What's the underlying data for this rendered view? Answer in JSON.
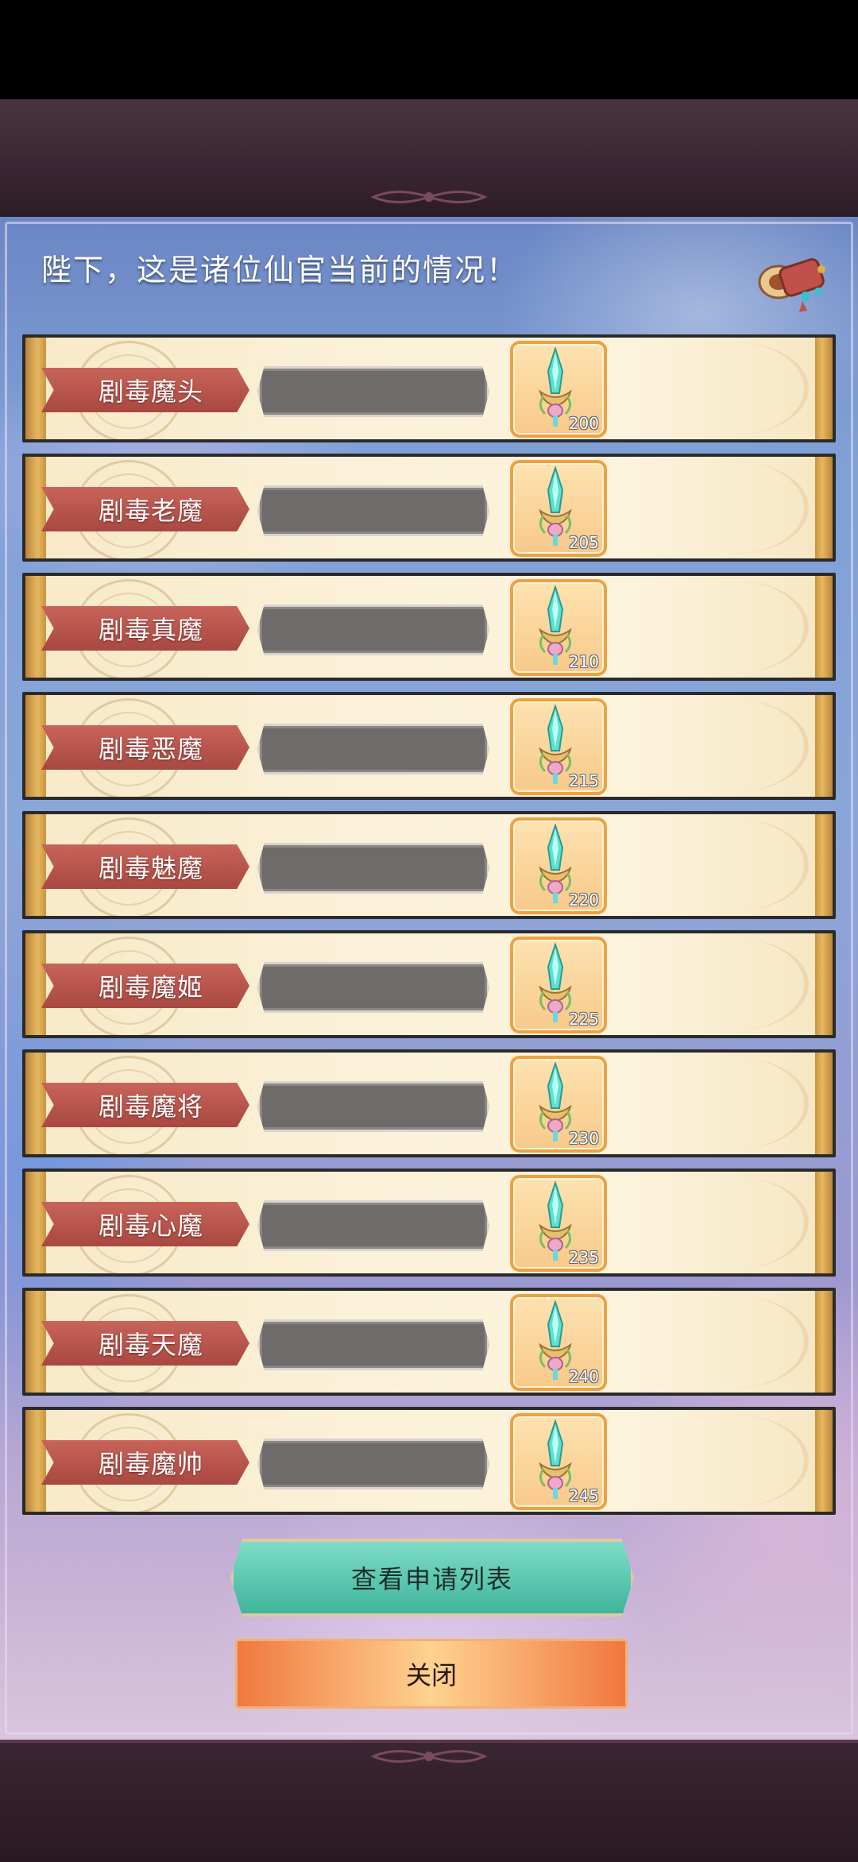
{
  "header": {
    "title": "陛下，这是诸位仙官当前的情况！"
  },
  "officials": [
    {
      "name": "剧毒魔头",
      "level": "200"
    },
    {
      "name": "剧毒老魔",
      "level": "205"
    },
    {
      "name": "剧毒真魔",
      "level": "210"
    },
    {
      "name": "剧毒恶魔",
      "level": "215"
    },
    {
      "name": "剧毒魅魔",
      "level": "220"
    },
    {
      "name": "剧毒魔姬",
      "level": "225"
    },
    {
      "name": "剧毒魔将",
      "level": "230"
    },
    {
      "name": "剧毒心魔",
      "level": "235"
    },
    {
      "name": "剧毒天魔",
      "level": "240"
    },
    {
      "name": "剧毒魔帅",
      "level": "245"
    }
  ],
  "buttons": {
    "view_applications": "查看申请列表",
    "close": "关闭"
  },
  "icons": {
    "corner": "scroll-icon",
    "reward": "sword-icon"
  },
  "colors": {
    "banner_red": "#b8524a",
    "button_teal": "#4fc1a8",
    "button_orange": "#f59a5a"
  }
}
